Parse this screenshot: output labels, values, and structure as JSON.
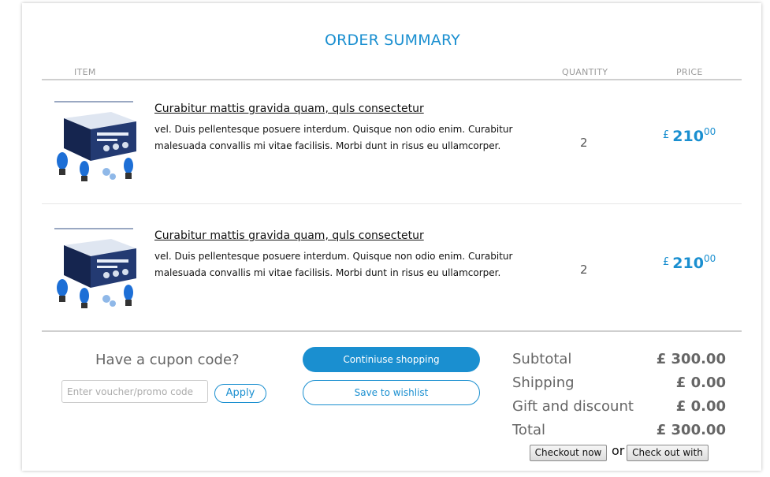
{
  "header": {
    "title": "ORDER SUMMARY",
    "col_item": "ITEM",
    "col_quantity": "QUANTITY",
    "col_price": "PRICE"
  },
  "items": [
    {
      "title": "Curabitur mattis gravida quam, quls consectetur",
      "description": "vel. Duis pellentesque posuere interdum. Quisque non odio enim. Curabitur malesuada convallis mi vitae facilisis. Morbi dunt in risus eu ullamcorper.",
      "quantity": "2",
      "price_currency": "£",
      "price_whole": "210",
      "price_cents": "00"
    },
    {
      "title": "Curabitur mattis gravida quam, quls consectetur",
      "description": "vel. Duis pellentesque posuere interdum. Quisque non odio enim. Curabitur malesuada convallis mi vitae facilisis. Morbi dunt in risus eu ullamcorper.",
      "quantity": "2",
      "price_currency": "£",
      "price_whole": "210",
      "price_cents": "00"
    }
  ],
  "coupon": {
    "title": "Have a cupon code?",
    "placeholder": "Enter voucher/promo code",
    "apply_label": "Apply"
  },
  "actions": {
    "continue_label": "Continiuse shopping",
    "wishlist_label": "Save to wishlist",
    "checkout_now_label": "Checkout now",
    "or_text": "or",
    "checkout_with_label": "Check out with"
  },
  "summary": {
    "subtotal_label": "Subtotal",
    "subtotal_value": "£ 300.00",
    "shipping_label": "Shipping",
    "shipping_value": "£ 0.00",
    "discount_label": "Gift and discount",
    "discount_value": "£ 0.00",
    "total_label": "Total",
    "total_value": "£ 300.00"
  },
  "colors": {
    "accent": "#1a8fd0",
    "muted_text": "#666666",
    "rule": "#cfcfcf"
  },
  "icons": {
    "product_image": "product-box-icon"
  }
}
